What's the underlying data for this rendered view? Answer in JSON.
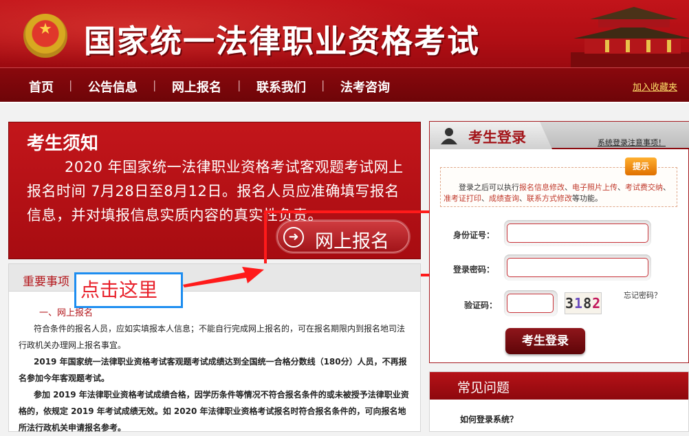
{
  "header": {
    "title": "国家统一法律职业资格考试",
    "emblem_glyph": "★"
  },
  "nav": {
    "items": [
      "首页",
      "公告信息",
      "网上报名",
      "联系我们",
      "法考咨询"
    ],
    "separator": "|",
    "favorite": "加入收藏夹"
  },
  "notice": {
    "title": "考生须知",
    "text": "2020 年国家统一法律职业资格考试客观题考试网上报名时间 7月28日至8月12日。报名人员应准确填写报名信息，并对填报信息实质内容的真实性负责。",
    "register_button": "网上报名",
    "register_icon": "arrow-right-circle-icon"
  },
  "annotation": {
    "click_here": "点击这里",
    "highlight_color": "#ff1a1a",
    "label_border_color": "#1d8df0"
  },
  "important": {
    "title": "重要事项",
    "section": "一、网上报名",
    "paragraphs": [
      "符合条件的报名人员，应如实填报本人信息；不能自行完成网上报名的，可在报名期限内到报名地司法行政机关办理网上报名事宜。",
      "2019 年国家统一法律职业资格考试客观题考试成绩达到全国统一合格分数线（180分）人员，不再报名参加今年客观题考试。",
      "参加 2019 年法律职业资格考试成绩合格，因学历条件等情况不符合报名条件的或未被授予法律职业资格的，依规定 2019 年考试成绩无效。如 2020 年法律职业资格考试报名时符合报名条件的，可向报名地所法行政机关申请报名参考。"
    ]
  },
  "login": {
    "title": "考生登录",
    "notes_link": "系统登录注意事项！",
    "tip_badge": "提示",
    "tip_prefix": "登录之后可以执行",
    "tip_links": [
      "报名信息修改",
      "电子照片上传",
      "考试费交纳",
      "准考证打印",
      "成绩查询",
      "联系方式修改"
    ],
    "tip_sep": "、",
    "tip_suffix": "等功能。",
    "id_label": "身份证号：",
    "password_label": "登录密码：",
    "captcha_label": "验证码：",
    "captcha_digits": [
      "3",
      "1",
      "8",
      "2"
    ],
    "forgot": "忘记密码？",
    "submit": "考生登录"
  },
  "faq": {
    "title": "常见问题",
    "question": "如何登录系统？"
  },
  "colors": {
    "brand_red": "#b00e14",
    "nav_dark": "#7a060b"
  }
}
